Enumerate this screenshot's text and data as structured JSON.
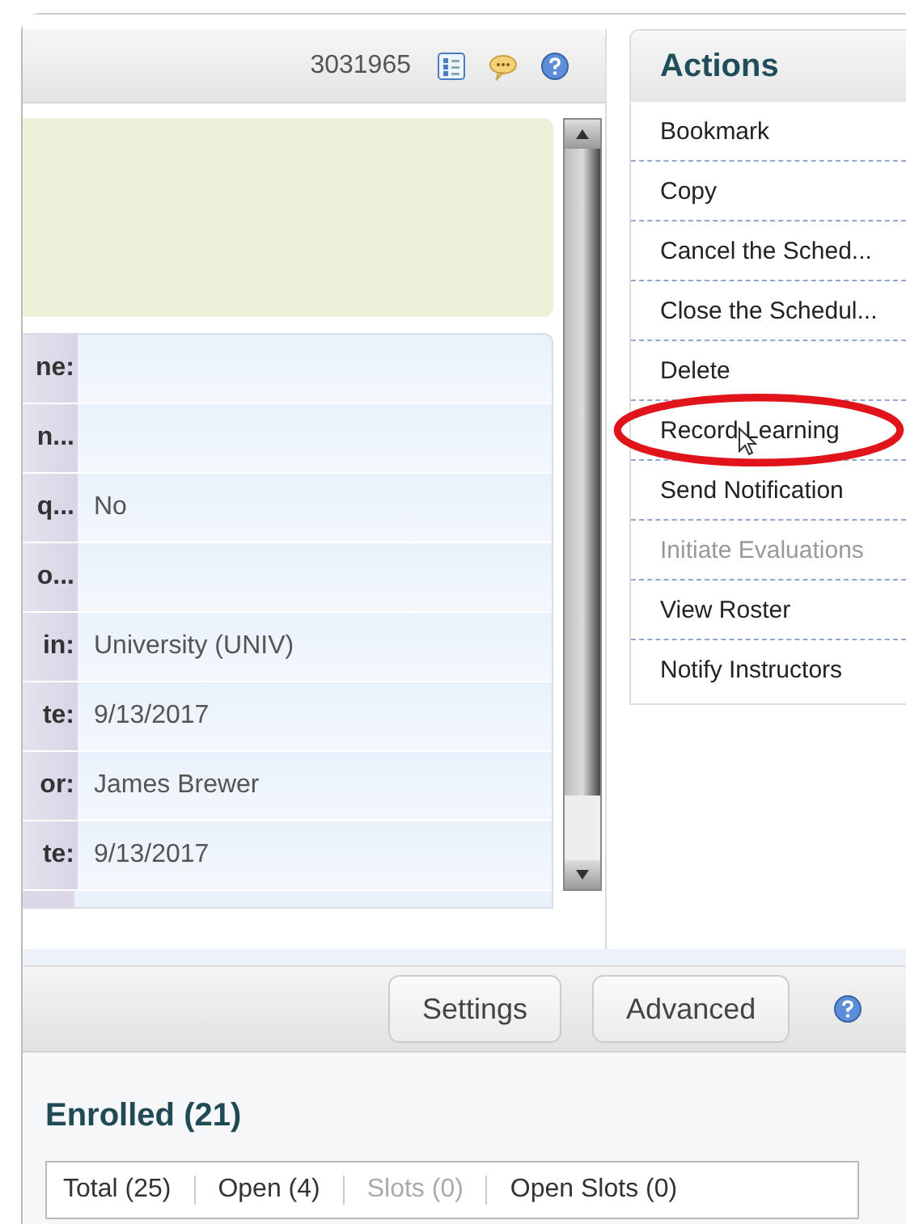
{
  "record": {
    "id": "3031965"
  },
  "details": [
    {
      "label": "ne:"
    },
    {
      "label": "n..."
    },
    {
      "label": "q...",
      "value": "No"
    },
    {
      "label": "o..."
    },
    {
      "label": "in:",
      "value": "University (UNIV)"
    },
    {
      "label": "te:",
      "value": "9/13/2017"
    },
    {
      "label": "or:",
      "value": "James Brewer"
    },
    {
      "label": "te:",
      "value": "9/13/2017"
    }
  ],
  "actions": {
    "title": "Actions",
    "items": [
      {
        "label": "Bookmark",
        "disabled": false,
        "highlighted": false
      },
      {
        "label": "Copy",
        "disabled": false,
        "highlighted": false
      },
      {
        "label": "Cancel the Sched...",
        "disabled": false,
        "highlighted": false
      },
      {
        "label": "Close the Schedul...",
        "disabled": false,
        "highlighted": false
      },
      {
        "label": "Delete",
        "disabled": false,
        "highlighted": false
      },
      {
        "label": "Record Learning",
        "disabled": false,
        "highlighted": true
      },
      {
        "label": "Send Notification",
        "disabled": false,
        "highlighted": false
      },
      {
        "label": "Initiate Evaluations",
        "disabled": true,
        "highlighted": false
      },
      {
        "label": "View Roster",
        "disabled": false,
        "highlighted": false
      },
      {
        "label": "Notify Instructors",
        "disabled": false,
        "highlighted": false
      }
    ]
  },
  "toolbar": {
    "buttons": [
      "Settings",
      "Advanced"
    ]
  },
  "enrolled": {
    "title": "Enrolled (21)",
    "stats": [
      {
        "label": "Total (25)",
        "disabled": false
      },
      {
        "label": "Open (4)",
        "disabled": false
      },
      {
        "label": "Slots (0)",
        "disabled": true
      },
      {
        "label": "Open Slots (0)",
        "disabled": false
      }
    ]
  }
}
